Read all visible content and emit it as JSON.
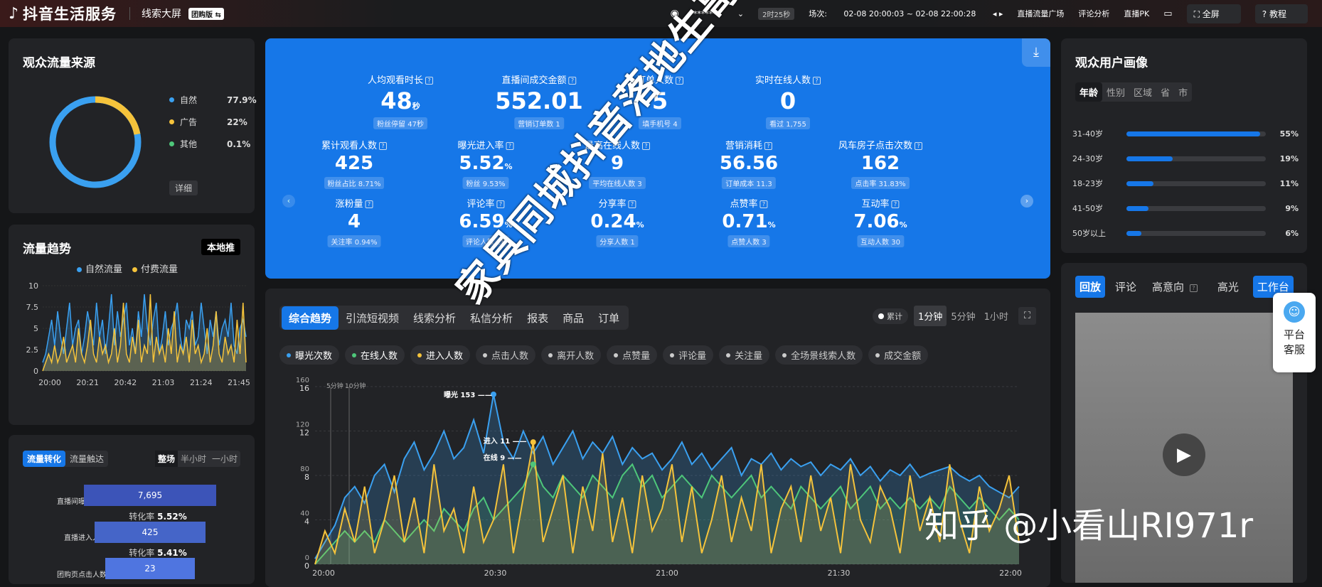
{
  "header": {
    "app_title": "抖音生活服务",
    "subtitle": "线索大屏",
    "badge": "团购版",
    "account": "*******",
    "duration": "2时25秒",
    "session_label": "场次:",
    "session_range": "02-08 20:00:03 ~ 02-08 22:00:28",
    "nav": [
      "直播流量广场",
      "评论分析",
      "直播PK"
    ],
    "fullscreen": "全屏",
    "tutorial": "教程"
  },
  "traffic_source": {
    "title": "观众流量来源",
    "items": [
      {
        "label": "自然",
        "value": "77.9%",
        "color": "#3aa0f0",
        "pct": 77.9
      },
      {
        "label": "广告",
        "value": "22%",
        "color": "#f5c33b",
        "pct": 22
      },
      {
        "label": "其他",
        "value": "0.1%",
        "color": "#4ec77a",
        "pct": 0.1
      }
    ],
    "detail_button": "详细"
  },
  "traffic_trend": {
    "title": "流量趋势",
    "tag": "本地推",
    "legend": [
      "自然流量",
      "付费流量"
    ],
    "yticks": [
      "10",
      "7.5",
      "5",
      "2.5",
      "0"
    ],
    "xticks": [
      "20:00",
      "20:21",
      "20:42",
      "21:03",
      "21:24",
      "21:45"
    ],
    "natural": [
      1,
      2,
      4,
      6,
      3,
      7,
      4,
      2,
      5,
      8,
      3,
      5,
      6,
      2,
      4,
      7,
      5,
      3,
      8,
      4,
      6,
      2,
      5,
      9,
      3,
      7,
      4,
      6,
      8,
      3,
      5,
      2,
      7,
      4,
      9,
      5,
      3,
      6,
      8,
      2,
      4,
      7,
      3,
      5,
      6,
      8,
      4,
      2,
      6,
      5,
      7,
      3,
      4,
      8,
      5,
      2,
      6,
      4,
      7,
      3,
      5,
      6,
      4,
      8,
      3,
      2,
      5,
      6,
      4
    ],
    "paid": [
      0,
      1,
      2,
      1,
      3,
      1,
      2,
      4,
      1,
      2,
      3,
      1,
      5,
      2,
      1,
      3,
      6,
      2,
      1,
      4,
      2,
      3,
      1,
      2,
      5,
      1,
      3,
      8,
      2,
      1,
      4,
      2,
      6,
      1,
      3,
      2,
      9,
      1,
      4,
      2,
      3,
      1,
      5,
      2,
      7,
      1,
      3,
      2,
      4,
      1,
      6,
      2,
      3,
      1,
      2,
      5,
      1,
      3,
      7,
      2,
      1,
      4,
      2,
      3,
      1,
      6,
      2,
      8,
      1
    ]
  },
  "funnel": {
    "tabs": [
      "流量转化",
      "流量触达"
    ],
    "ranges": [
      "整场",
      "半小时",
      "一小时"
    ],
    "rows": [
      {
        "label": "直播间曝光人数",
        "value": "7,695"
      },
      {
        "label": "直播进入人数",
        "value": "425"
      },
      {
        "label": "团购页点击人数",
        "value": "23"
      }
    ],
    "rate_label": "转化率",
    "rates": [
      "5.52%",
      "5.41%"
    ]
  },
  "metrics": {
    "row1": [
      {
        "label": "人均观看时长",
        "value": "48",
        "unit": "秒",
        "sub": "粉丝停留 47秒"
      },
      {
        "label": "直播间成交金额",
        "value": "552.01",
        "unit": "",
        "sub": "营销订单数 1"
      },
      {
        "label": "订单人数",
        "value": "5",
        "unit": "",
        "sub": "填手机号 4"
      },
      {
        "label": "实时在线人数",
        "value": "0",
        "unit": "",
        "sub": "看过 1,755"
      }
    ],
    "row2": [
      {
        "label": "累计观看人数",
        "value": "425",
        "unit": "",
        "sub": "粉丝占比 8.71%"
      },
      {
        "label": "曝光进入率",
        "value": "5.52",
        "unit": "%",
        "sub": "粉丝 9.53%"
      },
      {
        "label": "最高在线人数",
        "value": "9",
        "unit": "",
        "sub": "平均在线人数 3"
      },
      {
        "label": "营销消耗",
        "value": "56.56",
        "unit": "",
        "sub": "订单成本 11.3"
      },
      {
        "label": "风车房子点击次数",
        "value": "162",
        "unit": "",
        "sub": "点击率 31.83%"
      }
    ],
    "row3": [
      {
        "label": "涨粉量",
        "value": "4",
        "unit": "",
        "sub": "关注率 0.94%"
      },
      {
        "label": "评论率",
        "value": "6.59",
        "unit": "%",
        "sub": "评论人数 28"
      },
      {
        "label": "分享率",
        "value": "0.24",
        "unit": "%",
        "sub": "分享人数 1"
      },
      {
        "label": "点赞率",
        "value": "0.71",
        "unit": "%",
        "sub": "点赞人数 3"
      },
      {
        "label": "互动率",
        "value": "7.06",
        "unit": "%",
        "sub": "互动人数 30"
      }
    ]
  },
  "main_chart": {
    "tabs": [
      "综合趋势",
      "引流短视频",
      "线索分析",
      "私信分析",
      "报表",
      "商品",
      "订单"
    ],
    "cumulative": "累计",
    "intervals": [
      "1分钟",
      "5分钟",
      "1小时"
    ],
    "series_chips": [
      {
        "label": "曝光次数",
        "color": "#3aa0f0"
      },
      {
        "label": "在线人数",
        "color": "#4ec77a"
      },
      {
        "label": "进入人数",
        "color": "#f5c33b"
      },
      {
        "label": "点击人数",
        "color": "#cccccc"
      },
      {
        "label": "离开人数",
        "color": "#cccccc"
      },
      {
        "label": "点赞量",
        "color": "#cccccc"
      },
      {
        "label": "评论量",
        "color": "#cccccc"
      },
      {
        "label": "关注量",
        "color": "#cccccc"
      },
      {
        "label": "全场景线索人数",
        "color": "#cccccc"
      },
      {
        "label": "成交金额",
        "color": "#cccccc"
      }
    ],
    "y_left": [
      "160",
      "120",
      "80",
      "40",
      "0"
    ],
    "y_right": [
      "16",
      "12",
      "8",
      "4",
      "0"
    ],
    "x_ticks": [
      "20:00",
      "20:30",
      "21:00",
      "21:30",
      "22:00"
    ],
    "markers": [
      "5分钟",
      "10分钟"
    ],
    "annotations": [
      "曝光 153",
      "进入 11",
      "在线 9"
    ]
  },
  "chart_data": {
    "type": "line",
    "x": [
      "20:00",
      "20:30",
      "21:00",
      "21:30",
      "22:00"
    ],
    "ylim": [
      0,
      160
    ],
    "y2lim": [
      0,
      16
    ],
    "series": [
      {
        "name": "曝光次数",
        "values": [
          5,
          20,
          35,
          60,
          70,
          55,
          80,
          90,
          65,
          95,
          110,
          85,
          100,
          120,
          95,
          105,
          130,
          100,
          153,
          110,
          95,
          120,
          100,
          115,
          90,
          105,
          120,
          95,
          110,
          100,
          115,
          90,
          105,
          95,
          100,
          85,
          95,
          110,
          90,
          100,
          85,
          95,
          105,
          80,
          95,
          90,
          100,
          85,
          95,
          88,
          92,
          80,
          90,
          85,
          95,
          80,
          88,
          75,
          85,
          80,
          90,
          78,
          82,
          85,
          88,
          80,
          75,
          80,
          70,
          65,
          60,
          70
        ]
      },
      {
        "name": "在线人数",
        "values": [
          0,
          1,
          2,
          3,
          2,
          3,
          2,
          4,
          3,
          2,
          3,
          4,
          3,
          5,
          4,
          3,
          5,
          6,
          4,
          5,
          6,
          7,
          9,
          7,
          6,
          8,
          7,
          6,
          8,
          7,
          6,
          8,
          9,
          7,
          8,
          6,
          7,
          8,
          7,
          6,
          8,
          7,
          6,
          7,
          8,
          6,
          7,
          6,
          5,
          7,
          6,
          5,
          6,
          7,
          5,
          6,
          7,
          5,
          6,
          5,
          6,
          5,
          6,
          5,
          7,
          6,
          5,
          6,
          5,
          4,
          5,
          4
        ]
      },
      {
        "name": "进入人数",
        "values": [
          0,
          3,
          1,
          5,
          2,
          7,
          1,
          4,
          8,
          2,
          6,
          1,
          9,
          3,
          5,
          1,
          7,
          2,
          4,
          9,
          1,
          6,
          11,
          2,
          5,
          8,
          1,
          7,
          3,
          10,
          2,
          6,
          1,
          8,
          3,
          5,
          9,
          2,
          7,
          1,
          4,
          8,
          2,
          6,
          3,
          9,
          1,
          5,
          7,
          2,
          8,
          3,
          6,
          1,
          9,
          4,
          2,
          7,
          5,
          1,
          8,
          3,
          6,
          2,
          9,
          4,
          1,
          7,
          3,
          5,
          8,
          2
        ]
      }
    ]
  },
  "audience": {
    "title": "观众用户画像",
    "tabs": [
      "年龄",
      "性别",
      "区域",
      "省",
      "市"
    ],
    "ages": [
      {
        "label": "31-40岁",
        "value": "55%",
        "pct": 55
      },
      {
        "label": "24-30岁",
        "value": "19%",
        "pct": 19
      },
      {
        "label": "18-23岁",
        "value": "11%",
        "pct": 11
      },
      {
        "label": "41-50岁",
        "value": "9%",
        "pct": 9
      },
      {
        "label": "50岁以上",
        "value": "6%",
        "pct": 6
      }
    ]
  },
  "replay": {
    "tabs": [
      "回放",
      "评论",
      "高意向",
      "高光",
      "工作台"
    ]
  },
  "service": {
    "label1": "平台",
    "label2": "客服"
  },
  "overlays": {
    "watermark": "家具同城抖音落地生哥",
    "zhihu": "知乎 @小看山RI971r"
  }
}
